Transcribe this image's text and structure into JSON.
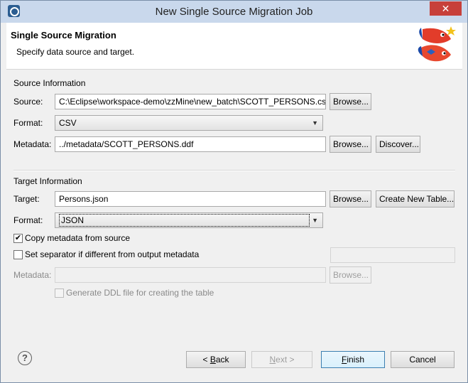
{
  "window": {
    "title": "New Single Source Migration Job",
    "close_label": "✕"
  },
  "banner": {
    "title": "Single Source Migration",
    "subtitle": "Specify data source and target."
  },
  "source": {
    "section_title": "Source Information",
    "source_label": "Source:",
    "source_value": "C:\\Eclipse\\workspace-demo\\zzMine\\new_batch\\SCOTT_PERSONS.csv",
    "browse_label": "Browse...",
    "format_label": "Format:",
    "format_value": "CSV",
    "metadata_label": "Metadata:",
    "metadata_value": "../metadata/SCOTT_PERSONS.ddf",
    "metadata_browse_label": "Browse...",
    "discover_label": "Discover..."
  },
  "target": {
    "section_title": "Target Information",
    "target_label": "Target:",
    "target_value": "Persons.json",
    "browse_label": "Browse...",
    "create_table_label": "Create New Table...",
    "format_label": "Format:",
    "format_value": "JSON",
    "copy_metadata_label": "Copy metadata from source",
    "copy_metadata_checked": true,
    "separator_label": "Set separator if different from output metadata",
    "separator_checked": false,
    "separator_value": "",
    "metadata_label": "Metadata:",
    "metadata_value": "",
    "metadata_browse_label": "Browse...",
    "ddl_label": "Generate DDL file for creating the table",
    "ddl_checked": false
  },
  "footer": {
    "help_label": "?",
    "back_prefix": "< ",
    "back_mnemonic": "B",
    "back_rest": "ack",
    "next_mnemonic": "N",
    "next_rest": "ext >",
    "finish_mnemonic": "F",
    "finish_rest": "inish",
    "cancel_label": "Cancel"
  }
}
